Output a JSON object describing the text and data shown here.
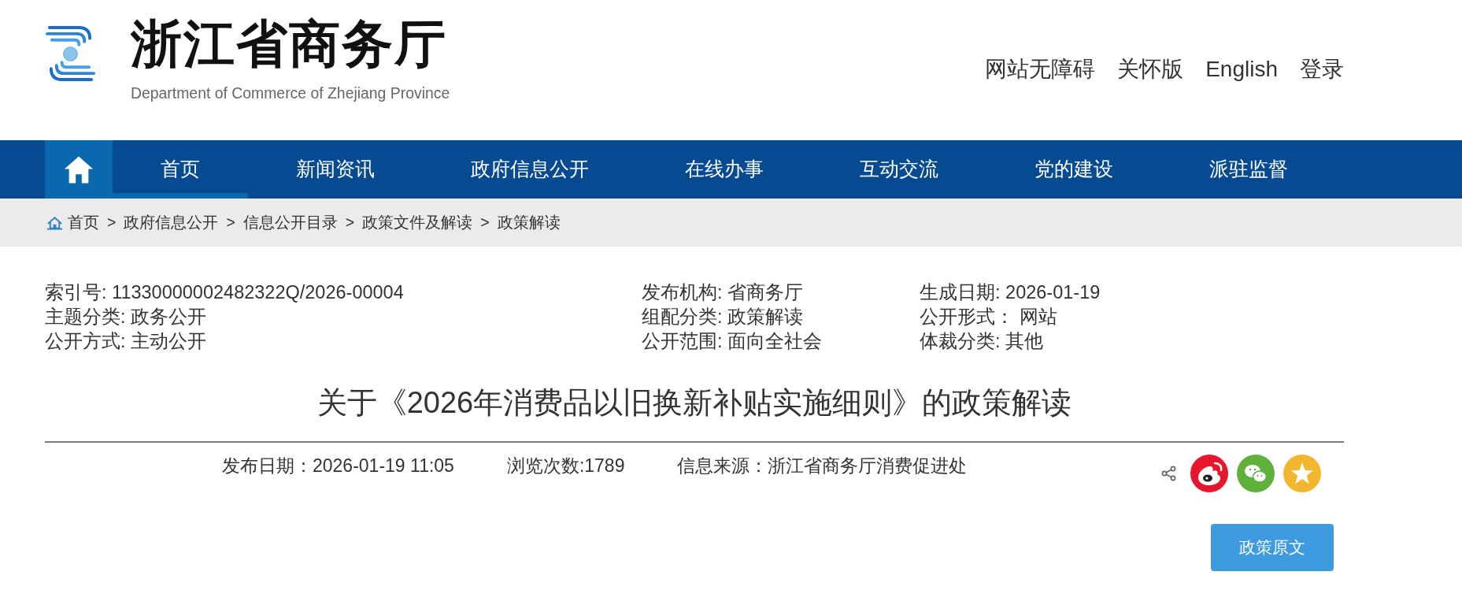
{
  "header": {
    "title": "浙江省商务厅",
    "subtitle": "Department of Commerce of Zhejiang Province",
    "links": [
      "网站无障碍",
      "关怀版",
      "English",
      "登录"
    ]
  },
  "nav": {
    "items": [
      {
        "label": "首页",
        "selected": true
      },
      {
        "label": "新闻资讯",
        "selected": false
      },
      {
        "label": "政府信息公开",
        "selected": false
      },
      {
        "label": "在线办事",
        "selected": false
      },
      {
        "label": "互动交流",
        "selected": false
      },
      {
        "label": "党的建设",
        "selected": false
      },
      {
        "label": "派驻监督",
        "selected": false
      }
    ]
  },
  "breadcrumb": {
    "items": [
      "首页",
      "政府信息公开",
      "信息公开目录",
      "政策文件及解读",
      "政策解读"
    ],
    "separator": ">"
  },
  "meta": [
    [
      "索引号: 11330000002482322Q/2026-00004",
      "发布机构: 省商务厅",
      "生成日期: 2026-01-19"
    ],
    [
      "主题分类: 政务公开",
      "组配分类: 政策解读",
      "公开形式： 网站"
    ],
    [
      "公开方式: 主动公开",
      "公开范围: 面向全社会",
      "体裁分类: 其他"
    ]
  ],
  "article": {
    "title": "关于《2026年消费品以旧换新补贴实施细则》的政策解读",
    "info": [
      "发布日期：2026-01-19 11:05",
      "浏览次数:1789",
      "信息来源：浙江省商务厅消费促进处"
    ],
    "original_button": "政策原文"
  }
}
